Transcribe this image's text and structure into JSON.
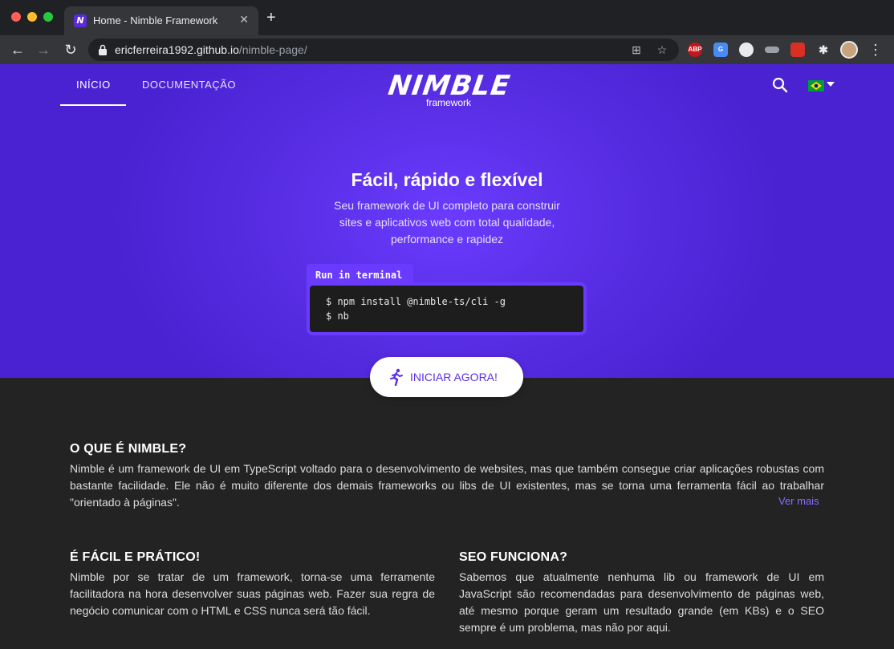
{
  "browser": {
    "tab_title": "Home - Nimble Framework",
    "tab_favicon": "N",
    "url_host": "ericferreira1992.github.io",
    "url_path": "/nimble-page/",
    "extensions": [
      "ABP",
      "G",
      "",
      "",
      "",
      ""
    ]
  },
  "nav": {
    "items": [
      {
        "label": "INÍCIO",
        "active": true
      },
      {
        "label": "DOCUMENTAÇÃO",
        "active": false
      }
    ],
    "logo_word": "NIMBLE",
    "logo_sub": "framework",
    "icons": [
      "search-icon",
      "brazil-flag-icon",
      "caret-down-icon"
    ]
  },
  "hero": {
    "title": "Fácil, rápido e flexível",
    "subtitle": "Seu framework de UI completo para construir sites e aplicativos web com total qualidade, performance e rapidez",
    "terminal_label": "Run in terminal",
    "terminal_lines": [
      "$ npm install @nimble-ts/cli -g",
      "$ nb"
    ],
    "cta_label": "INICIAR AGORA!"
  },
  "sections": {
    "what_is": {
      "title": "O QUE É NIMBLE?",
      "text": "Nimble é um framework de UI em TypeScript voltado para o desenvolvimento de websites, mas que também consegue criar aplicações robustas com bastante facilidade. Ele não é muito diferente dos demais frameworks ou libs de UI existentes, mas se torna uma ferramenta fácil ao trabalhar \"orientado à páginas\".",
      "more_link": "Ver mais"
    },
    "easy": {
      "title": "É FÁCIL E PRÁTICO!",
      "text": "Nimble por se tratar de um framework, torna-se uma ferramente facilitadora na hora desenvolver suas páginas web. Fazer sua regra de negócio comunicar com o HTML e CSS nunca será tão fácil."
    },
    "seo": {
      "title": "SEO FUNCIONA?",
      "text": "Sabemos que atualmente nenhuma lib ou framework de UI em JavaScript são recomendadas para desenvolvimento de páginas web, até mesmo porque geram um resultado grande (em KBs) e o SEO sempre é um problema, mas não por aqui."
    }
  },
  "colors": {
    "brand_purple": "#5a2fe6",
    "terminal_frame": "#6a3bff",
    "link": "#8a6bff"
  }
}
